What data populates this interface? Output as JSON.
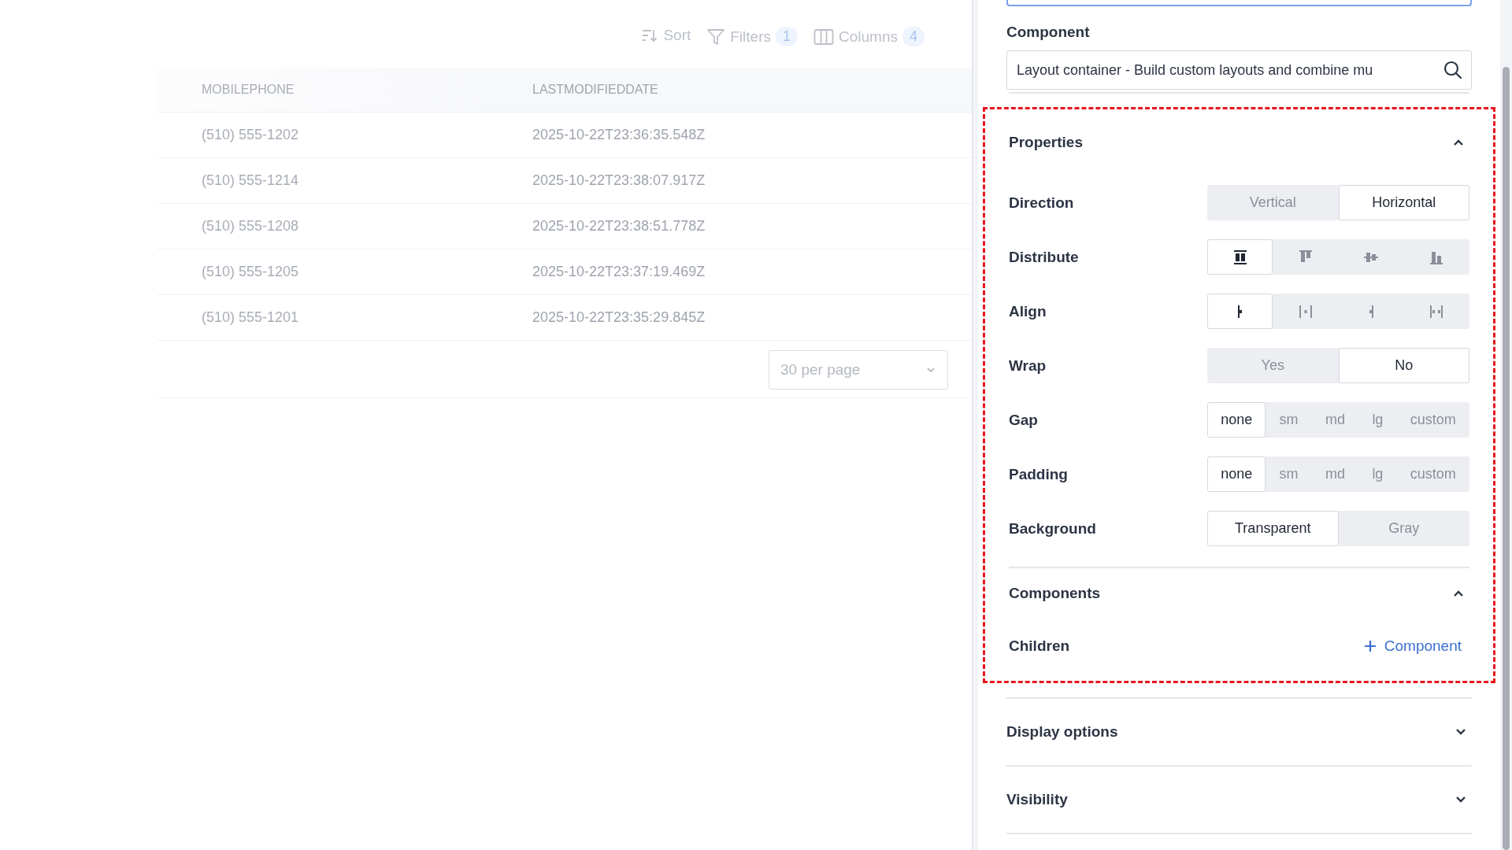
{
  "toolbar": {
    "sort": "Sort",
    "filters": {
      "label": "Filters",
      "count": "1"
    },
    "columns": {
      "label": "Columns",
      "count": "4"
    }
  },
  "table": {
    "columns": [
      "MOBILEPHONE",
      "LASTMODIFIEDDATE"
    ],
    "rows": [
      [
        "(510) 555-1202",
        "2025-10-22T23:36:35.548Z"
      ],
      [
        "(510) 555-1214",
        "2025-10-22T23:38:07.917Z"
      ],
      [
        "(510) 555-1208",
        "2025-10-22T23:38:51.778Z"
      ],
      [
        "(510) 555-1205",
        "2025-10-22T23:37:19.469Z"
      ],
      [
        "(510) 555-1201",
        "2025-10-22T23:35:29.845Z"
      ]
    ]
  },
  "pagination": {
    "per_page": "30 per page"
  },
  "panel": {
    "component_label": "Component",
    "component_value": "Layout container - Build custom layouts and combine mu",
    "highlight_sections": [
      {
        "title": "Properties",
        "expanded": true,
        "rows": [
          {
            "label": "Direction",
            "kind": "segmented",
            "options": [
              {
                "label": "Vertical",
                "selected": false
              },
              {
                "label": "Horizontal",
                "selected": true
              }
            ]
          },
          {
            "label": "Distribute",
            "kind": "distribute",
            "options": [
              {
                "selected": true
              },
              {
                "selected": false
              },
              {
                "selected": false
              },
              {
                "selected": false
              }
            ]
          },
          {
            "label": "Align",
            "kind": "align",
            "options": [
              {
                "selected": true
              },
              {
                "selected": false
              },
              {
                "selected": false
              },
              {
                "selected": false
              }
            ]
          },
          {
            "label": "Wrap",
            "kind": "segmented",
            "options": [
              {
                "label": "Yes",
                "selected": false
              },
              {
                "label": "No",
                "selected": true
              }
            ]
          },
          {
            "label": "Gap",
            "kind": "sizes",
            "options": [
              {
                "label": "none",
                "selected": true
              },
              {
                "label": "sm",
                "selected": false
              },
              {
                "label": "md",
                "selected": false
              },
              {
                "label": "lg",
                "selected": false
              },
              {
                "label": "custom",
                "selected": false
              }
            ]
          },
          {
            "label": "Padding",
            "kind": "sizes",
            "options": [
              {
                "label": "none",
                "selected": true
              },
              {
                "label": "sm",
                "selected": false
              },
              {
                "label": "md",
                "selected": false
              },
              {
                "label": "lg",
                "selected": false
              },
              {
                "label": "custom",
                "selected": false
              }
            ]
          },
          {
            "label": "Background",
            "kind": "segmented",
            "options": [
              {
                "label": "Transparent",
                "selected": true
              },
              {
                "label": "Gray",
                "selected": false
              }
            ]
          }
        ]
      },
      {
        "title": "Components",
        "expanded": true,
        "rows": [
          {
            "label": "Children",
            "kind": "add",
            "action": "Component"
          }
        ]
      }
    ],
    "sections": [
      {
        "title": "Display options",
        "expanded": false
      },
      {
        "title": "Visibility",
        "expanded": false
      }
    ]
  }
}
